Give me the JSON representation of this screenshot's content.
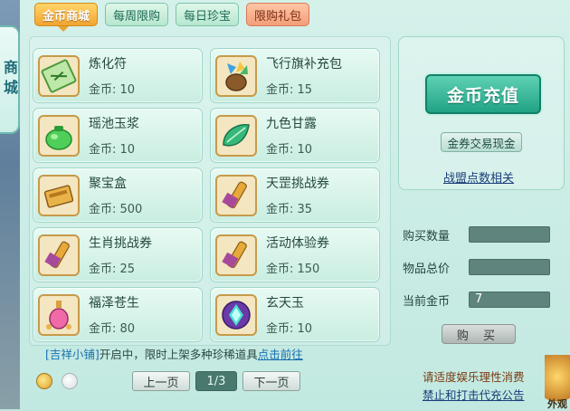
{
  "side_tab": {
    "label": "商城"
  },
  "tabs": [
    {
      "label": "金币商城",
      "active": true
    },
    {
      "label": "每周限购"
    },
    {
      "label": "每日珍宝"
    },
    {
      "label": "限购礼包"
    }
  ],
  "items": [
    {
      "name": "炼化符",
      "price": "金币: 10",
      "icon": "talisman-icon"
    },
    {
      "name": "飞行旗补充包",
      "price": "金币: 15",
      "icon": "flag-pouch-icon"
    },
    {
      "name": "瑶池玉浆",
      "price": "金币: 10",
      "icon": "green-pouch-icon"
    },
    {
      "name": "九色甘露",
      "price": "金币: 10",
      "icon": "jade-leaf-icon"
    },
    {
      "name": "聚宝盒",
      "price": "金币: 500",
      "icon": "treasure-box-icon"
    },
    {
      "name": "天罡挑战券",
      "price": "金币: 35",
      "icon": "scroll-icon"
    },
    {
      "name": "生肖挑战券",
      "price": "金币: 25",
      "icon": "scroll-icon"
    },
    {
      "name": "活动体验券",
      "price": "金币: 150",
      "icon": "scroll-icon"
    },
    {
      "name": "福泽苍生",
      "price": "金币: 80",
      "icon": "potion-icon"
    },
    {
      "name": "玄天玉",
      "price": "金币: 10",
      "icon": "purple-gem-icon"
    }
  ],
  "promo": {
    "bracket": "[吉祥小铺]",
    "text": "开启中，限时上架多种珍稀道具",
    "link": "点击前往"
  },
  "pager": {
    "prev": "上一页",
    "indicator": "1/3",
    "next": "下一页"
  },
  "right": {
    "recharge": "金币充值",
    "exchange": "金券交易现金",
    "league": "战盟点数相关"
  },
  "form": {
    "qty_label": "购买数量",
    "qty_value": "",
    "total_label": "物品总价",
    "total_value": "",
    "current_label": "当前金币",
    "current_value": "7"
  },
  "buy_label": "购 买",
  "notice": {
    "line1": "请适度娱乐理性消费",
    "line2": "禁止和打击代充公告"
  },
  "corner_text": "外观"
}
